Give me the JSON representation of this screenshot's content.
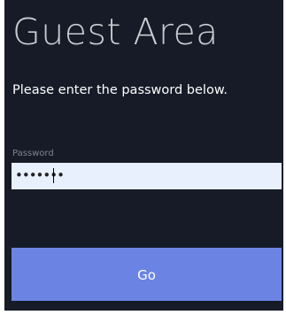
{
  "login": {
    "title": "Guest Area",
    "subtitle": "Please enter the password below.",
    "password_label": "Password",
    "password_masked": "•••••••",
    "submit_label": "Go"
  },
  "colors": {
    "background": "#161b27",
    "title": "#c9ccd1",
    "input_background": "#e8f0fe",
    "button": "#6b84e3"
  }
}
